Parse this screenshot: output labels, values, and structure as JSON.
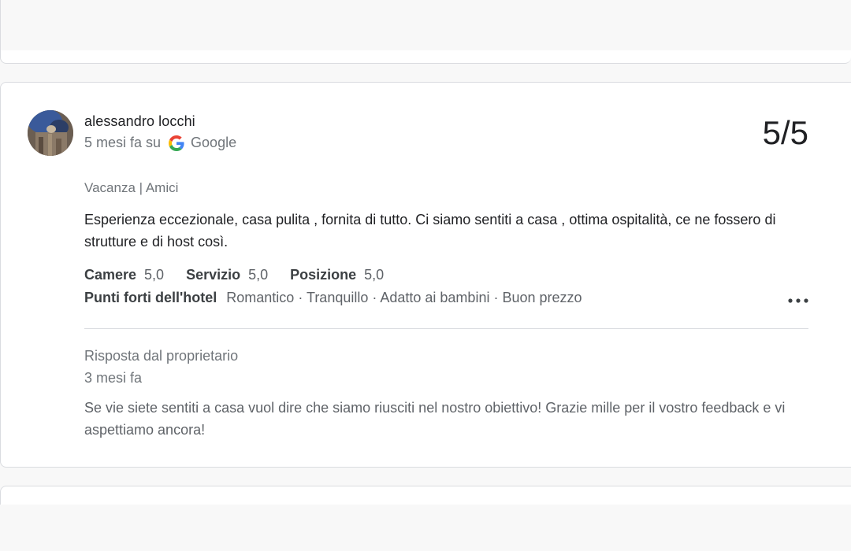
{
  "review": {
    "author": "alessandro locchi",
    "time_prefix": "5 mesi fa su",
    "source": "Google",
    "score": "5/5",
    "trip_type": "Vacanza | Amici",
    "text": "Esperienza eccezionale, casa pulita , fornita di tutto. Ci siamo sentiti a casa , ottima ospitalità, ce ne fossero di strutture e di host così.",
    "ratings": [
      {
        "label": "Camere",
        "value": "5,0"
      },
      {
        "label": "Servizio",
        "value": "5,0"
      },
      {
        "label": "Posizione",
        "value": "5,0"
      }
    ],
    "highlights_label": "Punti forti dell'hotel",
    "highlights_value": "Romantico · Tranquillo · Adatto ai bambini · Buon prezzo",
    "more_icon": "more-horizontal-icon"
  },
  "owner_response": {
    "title": "Risposta dal proprietario",
    "time": "3 mesi fa",
    "text": "Se vie siete sentiti a casa vuol dire che siamo riusciti nel nostro obiettivo! Grazie mille per il vostro feedback e vi aspettiamo ancora!"
  },
  "colors": {
    "google_blue": "#4285F4",
    "google_red": "#EA4335",
    "google_yellow": "#FBBC05",
    "google_green": "#34A853"
  }
}
